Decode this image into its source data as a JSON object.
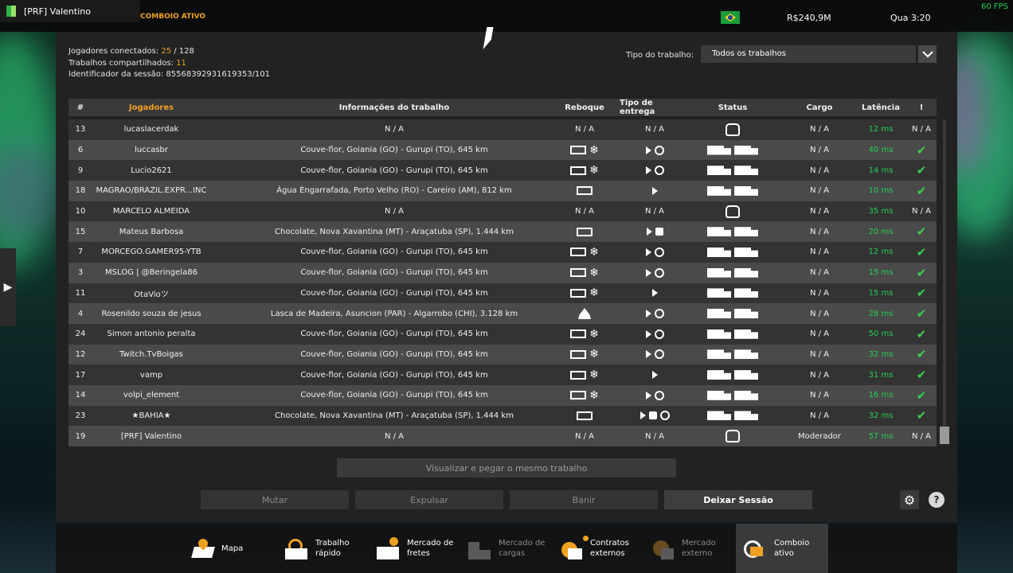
{
  "topbar": {
    "user_label": "[PRF] Valentino",
    "convoy_status": "COMBOIO ATIVO",
    "money": "R$240,9M",
    "clock": "Qua 3:20",
    "fps": "60 FPS"
  },
  "session": {
    "players_label": "Jogadores conectados:",
    "players_connected": "25",
    "players_max": "/ 128",
    "jobs_label": "Trabalhos compartilhados:",
    "jobs_shared": "11",
    "id_label": "Identificador da sessão:",
    "session_id": "85568392931619353/101"
  },
  "filter": {
    "label": "Tipo do trabalho:",
    "selected": "Todos os trabalhos"
  },
  "table": {
    "headers": {
      "num": "#",
      "player": "Jogadores",
      "info": "Informações do trabalho",
      "trailer": "Reboque",
      "delivery": "Tipo de entrega",
      "status": "Status",
      "cargo": "Cargo",
      "latency": "Latência",
      "alert": "!"
    },
    "rows": [
      {
        "num": "13",
        "player": "lucaslacerdak",
        "info": "N / A",
        "trailer": "N / A",
        "delivery": "N / A",
        "cargo": "N / A",
        "latency": "12 ms",
        "ok": "N / A"
      },
      {
        "num": "6",
        "player": "luccasbr",
        "info": "Couve-flor, Goiania (GO) - Gurupi (TO), 645 km",
        "cargo": "N / A",
        "latency": "40 ms"
      },
      {
        "num": "9",
        "player": "Lucio2621",
        "info": "Couve-flor, Goiania (GO) - Gurupi (TO), 645 km",
        "cargo": "N / A",
        "latency": "14 ms"
      },
      {
        "num": "18",
        "player": "MAGRAO/BRAZIL.EXPR...INC",
        "info": "Água Engarrafada, Porto Velho (RO) - Careiro (AM), 812 km",
        "cargo": "N / A",
        "latency": "10 ms"
      },
      {
        "num": "10",
        "player": "MARCELO ALMEIDA",
        "info": "N / A",
        "trailer": "N / A",
        "delivery": "N / A",
        "cargo": "N / A",
        "latency": "35 ms",
        "ok": "N / A"
      },
      {
        "num": "15",
        "player": "Mateus Barbosa",
        "info": "Chocolate, Nova Xavantina (MT) - Araçatuba (SP), 1.444 km",
        "cargo": "N / A",
        "latency": "20 ms"
      },
      {
        "num": "7",
        "player": "MORCEGO.GAMER95-YTB",
        "info": "Couve-flor, Goiania (GO) - Gurupi (TO), 645 km",
        "cargo": "N / A",
        "latency": "12 ms"
      },
      {
        "num": "3",
        "player": "MSLOG | @Beringela86",
        "info": "Couve-flor, Goiania (GO) - Gurupi (TO), 645 km",
        "cargo": "N / A",
        "latency": "15 ms"
      },
      {
        "num": "11",
        "player": "OtaVioツ",
        "info": "Couve-flor, Goiania (GO) - Gurupi (TO), 645 km",
        "cargo": "N / A",
        "latency": "15 ms"
      },
      {
        "num": "4",
        "player": "Rosenildo souza de jesus",
        "info": "Lasca de Madeira, Asuncion (PAR) - Algarrobo (CHI), 3.128 km",
        "cargo": "N / A",
        "latency": "28 ms"
      },
      {
        "num": "24",
        "player": "Simon antonio peralta",
        "info": "Couve-flor, Goiania (GO) - Gurupi (TO), 645 km",
        "cargo": "N / A",
        "latency": "50 ms"
      },
      {
        "num": "12",
        "player": "Twitch.TvBoigas",
        "info": "Couve-flor, Goiania (GO) - Gurupi (TO), 645 km",
        "cargo": "N / A",
        "latency": "32 ms"
      },
      {
        "num": "17",
        "player": "vamp",
        "info": "Couve-flor, Goiania (GO) - Gurupi (TO), 645 km",
        "cargo": "N / A",
        "latency": "31 ms"
      },
      {
        "num": "14",
        "player": "volpi_element",
        "info": "Couve-flor, Goiania (GO) - Gurupi (TO), 645 km",
        "cargo": "N / A",
        "latency": "16 ms"
      },
      {
        "num": "23",
        "player": "★BAHIA★",
        "info": "Chocolate, Nova Xavantina (MT) - Araçatuba (SP), 1.444 km",
        "cargo": "N / A",
        "latency": "32 ms"
      },
      {
        "num": "19",
        "player": "[PRF] Valentino",
        "info": "N / A",
        "trailer": "N / A",
        "delivery": "N / A",
        "cargo": "Moderador",
        "latency": "57 ms",
        "ok": "N / A"
      }
    ]
  },
  "buttons": {
    "view_job": "Visualizar e pegar o mesmo trabalho",
    "mute": "Mutar",
    "kick": "Expulsar",
    "ban": "Banir",
    "leave": "Deixar Sessão",
    "help": "?"
  },
  "nav": {
    "map": "Mapa",
    "quick_job_1": "Trabalho",
    "quick_job_2": "rápido",
    "freight_1": "Mercado de",
    "freight_2": "fretes",
    "cargo_1": "Mercado de",
    "cargo_2": "cargas",
    "contracts_1": "Contratos",
    "contracts_2": "externos",
    "ext_1": "Mercado",
    "ext_2": "externo",
    "convoy_1": "Comboio",
    "convoy_2": "ativo"
  },
  "colors": {
    "accent": "#f0a020",
    "latency": "#23d04f",
    "check": "#39d04a"
  }
}
